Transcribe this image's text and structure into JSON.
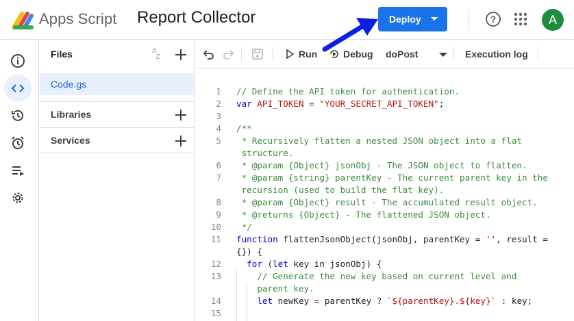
{
  "header": {
    "app_name": "Apps Script",
    "project_title": "Report Collector",
    "deploy_label": "Deploy",
    "avatar_initial": "A"
  },
  "files_panel": {
    "title": "Files",
    "files": [
      "Code.gs"
    ],
    "sections": [
      "Libraries",
      "Services"
    ]
  },
  "toolbar": {
    "run_label": "Run",
    "debug_label": "Debug",
    "function_select": "doPost",
    "execution_log_label": "Execution log"
  },
  "editor": {
    "line_numbers": [
      "1",
      "2",
      "3",
      "4",
      "5",
      "",
      "6",
      "7",
      "",
      "8",
      "9",
      "10",
      "11",
      "",
      "12",
      "13",
      "",
      "14",
      "15"
    ],
    "lines": [
      "// Define the API token for authentication.",
      "var API_TOKEN = \"YOUR_SECRET_API_TOKEN\";",
      "",
      "/**",
      " * Recursively flatten a nested JSON object into a flat",
      " structure.",
      " * @param {Object} jsonObj - The JSON object to flatten.",
      " * @param {string} parentKey - The current parent key in the",
      " recursion (used to build the flat key).",
      " * @param {Object} result - The accumulated result object.",
      " * @returns {Object} - The flattened JSON object.",
      " */",
      "function flattenJsonObject(jsonObj, parentKey = '', result =",
      "{}) {",
      "  for (let key in jsonObj) {",
      "    // Generate the new key based on current level and",
      "    parent key.",
      "    let newKey = parentKey ? `${parentKey}.${key}` : key;",
      ""
    ]
  },
  "colors": {
    "accent": "#1a73e8",
    "annotation_arrow": "#0b1fe0",
    "comment": "#3c8c3c",
    "keyword": "#0000cc",
    "string": "#b31412"
  }
}
